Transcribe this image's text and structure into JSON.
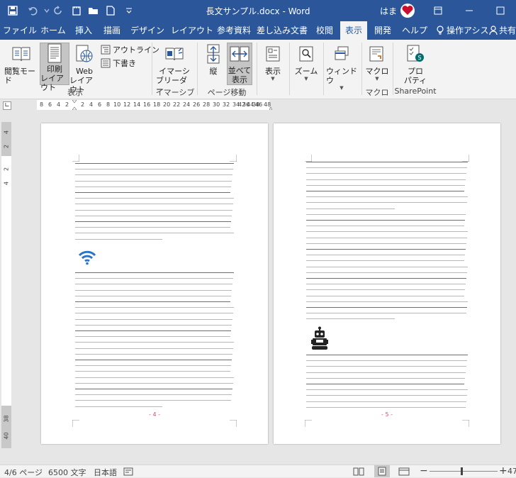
{
  "title_bar": {
    "document_title": "長文サンプル.docx  -  Word",
    "user_name": "はま",
    "save_icon": "save-icon",
    "undo_icon": "undo-icon",
    "redo_icon": "redo-icon",
    "open_icon": "open-folder-icon",
    "new_icon": "new-document-icon",
    "customize_icon": "dropdown-icon"
  },
  "tabs": [
    {
      "label": "ファイル",
      "active": false
    },
    {
      "label": "ホーム",
      "active": false
    },
    {
      "label": "挿入",
      "active": false
    },
    {
      "label": "描画",
      "active": false
    },
    {
      "label": "デザイン",
      "active": false
    },
    {
      "label": "レイアウト",
      "active": false
    },
    {
      "label": "参考資料",
      "active": false
    },
    {
      "label": "差し込み文書",
      "active": false
    },
    {
      "label": "校閲",
      "active": false
    },
    {
      "label": "表示",
      "active": true
    },
    {
      "label": "開発",
      "active": false
    },
    {
      "label": "ヘルプ",
      "active": false
    },
    {
      "label": "操作アシス",
      "active": false
    },
    {
      "label": "共有",
      "active": false
    }
  ],
  "ribbon": {
    "views": {
      "read_mode": "閲覧モード",
      "print_layout_1": "印刷",
      "print_layout_2": "レイアウト",
      "web_layout_1": "Web",
      "web_layout_2": "レイアウト",
      "outline": "アウトライン",
      "draft": "下書き",
      "group": "表示"
    },
    "immersive": {
      "reader_1": "イマーシ",
      "reader_2": "ブリーダー",
      "group": "イマーシブ"
    },
    "page_movement": {
      "vertical": "縦",
      "side_by_side_1": "並べて",
      "side_by_side_2": "表示",
      "group": "ページ移動"
    },
    "show": {
      "label": "表示"
    },
    "zoom": {
      "label": "ズーム"
    },
    "window": {
      "label": "ウィンドウ"
    },
    "macros": {
      "label": "マクロ",
      "group": "マクロ"
    },
    "properties": {
      "label_1": "プロ",
      "label_2": "パティ",
      "group": "SharePoint"
    }
  },
  "ruler": {
    "numbers_left": [
      "8",
      "6",
      "4",
      "2"
    ],
    "numbers_main": [
      "2",
      "4",
      "6",
      "8",
      "10",
      "12",
      "14",
      "16",
      "18",
      "20",
      "22",
      "24",
      "26",
      "28",
      "30",
      "32",
      "34",
      "36",
      "38"
    ],
    "numbers_right": [
      "42",
      "44",
      "46",
      "48"
    ]
  },
  "vertical_ruler": [
    "4",
    "2",
    "2",
    "4",
    "38",
    "40"
  ],
  "pages": [
    {
      "number": "- 4 -"
    },
    {
      "number": "- 5 -"
    }
  ],
  "status_bar": {
    "page": "4/6 ページ",
    "words": "6500 文字",
    "language": "日本語",
    "zoom": "47"
  },
  "colors": {
    "brand": "#2b579a",
    "ribbon_bg": "#f3f3f3",
    "page_number": "#e0486a",
    "wifi_icon": "#2e75c5"
  }
}
